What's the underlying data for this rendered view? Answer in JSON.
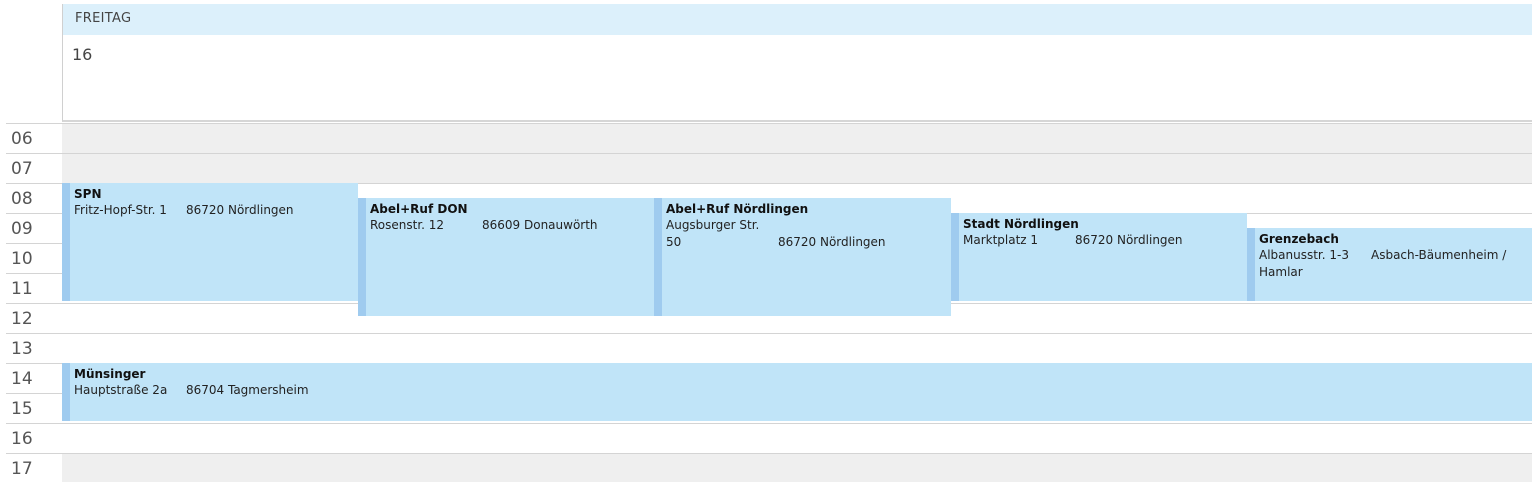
{
  "header": {
    "day_name": "FREITAG",
    "date": "16"
  },
  "hours": [
    "06",
    "07",
    "08",
    "09",
    "10",
    "11",
    "12",
    "13",
    "14",
    "15",
    "16",
    "17"
  ],
  "events": [
    {
      "title": "SPN",
      "street": "Fritz-Hopf-Str. 1",
      "city": "86720 Nördlingen",
      "time": "08:00–12:00"
    },
    {
      "title": "Abel+Ruf DON",
      "street": "Rosenstr. 12",
      "city": "86609 Donauwörth",
      "time": "08:30–12:30"
    },
    {
      "title": "Abel+Ruf Nördlingen",
      "street": "Augsburger Str. 50",
      "city": "86720 Nördlingen",
      "time": "08:30–12:30"
    },
    {
      "title": "Stadt Nördlingen",
      "street": "Marktplatz 1",
      "city": "86720 Nördlingen",
      "time": "09:00–12:00"
    },
    {
      "title": "Grenzebach",
      "street": "Albanusstr. 1-3",
      "city": "Asbach-Bäumenheim / Hamlar",
      "time": "09:30–12:00"
    },
    {
      "title": "Münsinger",
      "street": "Hauptstraße 2a",
      "city": "86704 Tagmersheim",
      "time": "14:00–16:00"
    }
  ],
  "colors": {
    "event_fill": "#c0e4f8",
    "event_bar": "#9fcbef",
    "header_fill": "#dcf0fb",
    "offhours_fill": "#efefef"
  }
}
